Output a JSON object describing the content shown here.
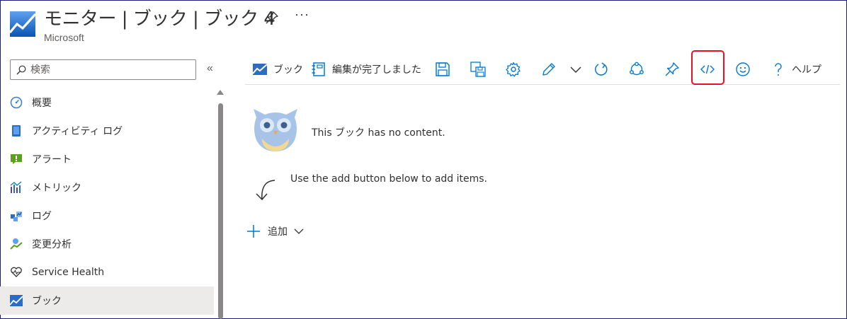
{
  "header": {
    "title": "モニター | ブック | ブック 4",
    "subtitle": "Microsoft",
    "more": "···"
  },
  "sidebar": {
    "search_placeholder": "検索",
    "collapse": "«",
    "items": [
      {
        "label": "概要",
        "icon": "gauge-icon"
      },
      {
        "label": "アクティビティ ログ",
        "icon": "activity-log-icon"
      },
      {
        "label": "アラート",
        "icon": "alert-icon"
      },
      {
        "label": "メトリック",
        "icon": "metrics-icon"
      },
      {
        "label": "ログ",
        "icon": "logs-icon"
      },
      {
        "label": "変更分析",
        "icon": "change-analysis-icon"
      },
      {
        "label": "Service Health",
        "icon": "heart-icon"
      },
      {
        "label": "ブック",
        "icon": "workbook-icon",
        "selected": true
      }
    ]
  },
  "toolbar": {
    "workbook_label": "ブック",
    "done_editing_label": "編集が完了しました",
    "help_label": "ヘルプ",
    "highlighted": "code-icon"
  },
  "content": {
    "empty_message": "This ブック has no content.",
    "hint": "Use the add button below to add items.",
    "add_label": "追加"
  },
  "colors": {
    "accent": "#0078d4",
    "highlight_border": "#e81123",
    "selected_bg": "#edebe9"
  }
}
